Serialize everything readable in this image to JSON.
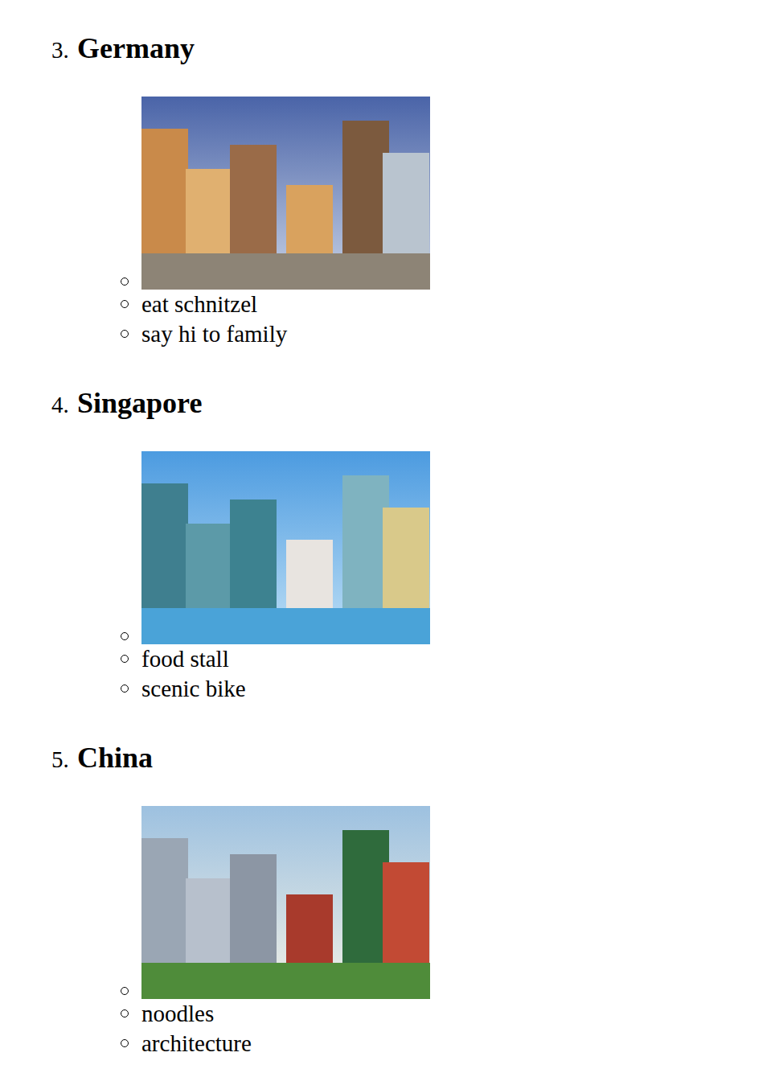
{
  "destinations": [
    {
      "number": "3.",
      "name": "Germany",
      "items": [
        {
          "kind": "photo"
        },
        {
          "kind": "text",
          "text": "eat schnitzel"
        },
        {
          "kind": "text",
          "text": "say hi to family"
        }
      ]
    },
    {
      "number": "4.",
      "name": "Singapore",
      "items": [
        {
          "kind": "photo"
        },
        {
          "kind": "text",
          "text": "food stall"
        },
        {
          "kind": "text",
          "text": "scenic bike"
        }
      ]
    },
    {
      "number": "5.",
      "name": "China",
      "items": [
        {
          "kind": "photo"
        },
        {
          "kind": "text",
          "text": "noodles"
        },
        {
          "kind": "text",
          "text": "architecture"
        }
      ]
    }
  ]
}
